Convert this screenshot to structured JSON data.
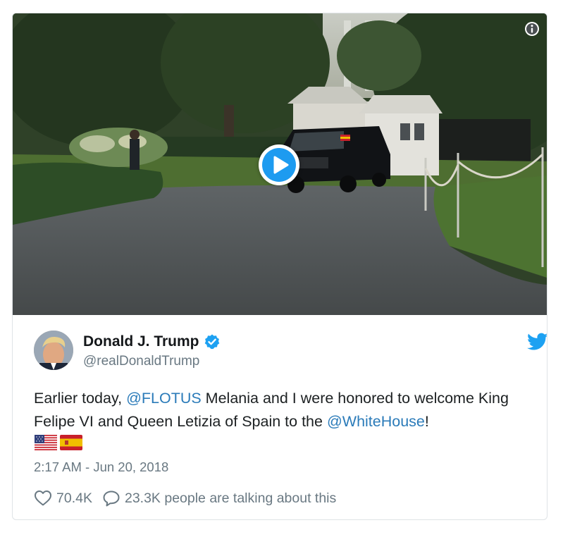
{
  "tweet": {
    "author_name": "Donald J. Trump",
    "author_handle": "@realDonaldTrump",
    "text_part1": "Earlier today, ",
    "mention_flotus": "@FLOTUS",
    "text_part2": " Melania and I were honored to welcome King Felipe VI and Queen Letizia of Spain to the ",
    "mention_whitehouse": "@WhiteHouse",
    "text_part3": "!",
    "flags": [
      "us-flag-emoji",
      "spain-flag-emoji"
    ],
    "timestamp": "2:17 AM - Jun 20, 2018",
    "likes": "70.4K",
    "talking": "23.3K people are talking about this"
  },
  "colors": {
    "link": "#2b7bb9",
    "verified": "#1da1f2",
    "twitter_blue": "#1da1f2",
    "play_button": "#1d9bf0",
    "muted_text": "#697882"
  },
  "icons": {
    "media_info": "info-icon",
    "play": "play-icon",
    "brand": "twitter-bird-icon",
    "verified": "verified-badge-icon",
    "like": "heart-icon",
    "reply": "speech-bubble-icon"
  }
}
